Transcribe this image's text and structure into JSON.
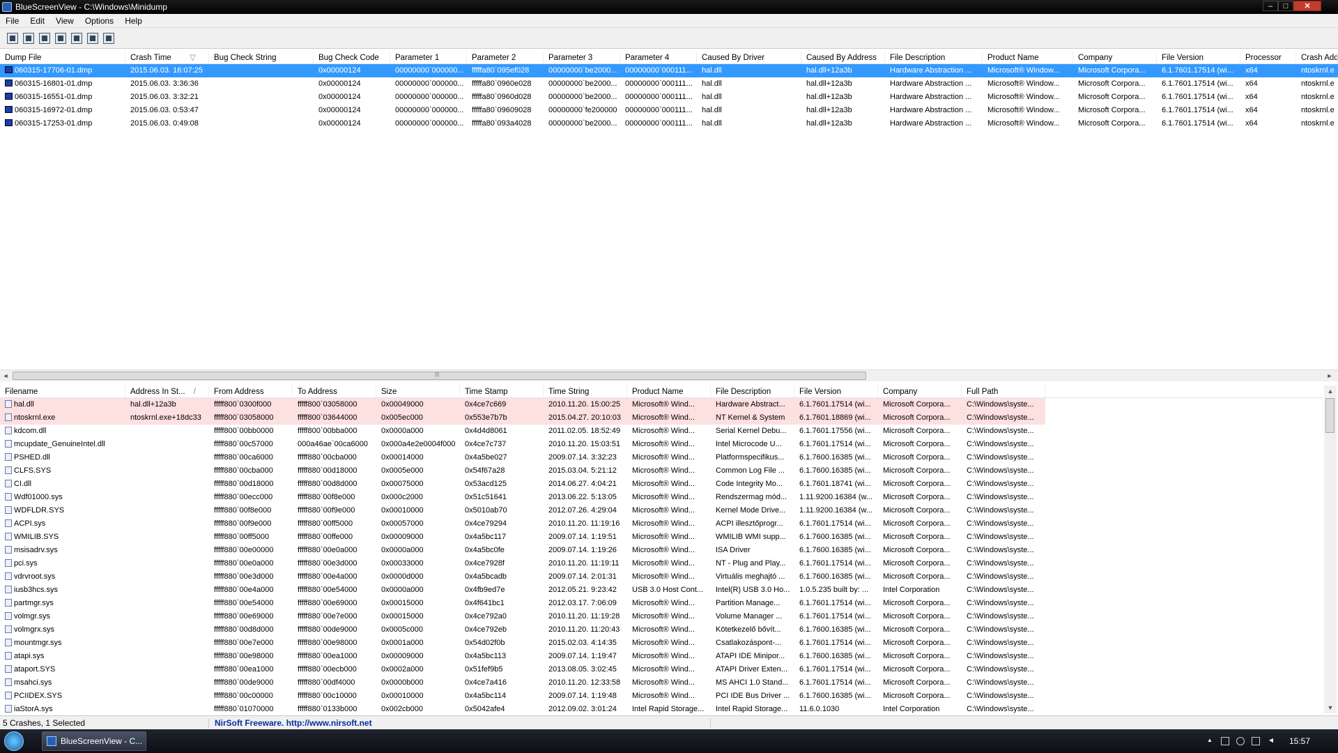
{
  "window": {
    "title": "BlueScreenView - C:\\Windows\\Minidump",
    "controls": {
      "minimize": "–",
      "maximize": "□",
      "close": "✕"
    }
  },
  "menu": [
    "File",
    "Edit",
    "View",
    "Options",
    "Help"
  ],
  "toolbar": {
    "icons": [
      "properties-icon",
      "save-icon",
      "refresh-icon",
      "copy-icon",
      "html-report-icon",
      "find-icon",
      "exit-icon"
    ]
  },
  "top_table": {
    "columns": [
      "Dump File",
      "Crash Time",
      "Bug Check String",
      "Bug Check Code",
      "Parameter 1",
      "Parameter 2",
      "Parameter 3",
      "Parameter 4",
      "Caused By Driver",
      "Caused By Address",
      "File Description",
      "Product Name",
      "Company",
      "File Version",
      "Processor",
      "Crash Add"
    ],
    "sort_indicator": "▽",
    "rows": [
      [
        "060315-17706-01.dmp",
        "2015.06.03. 16:07:25",
        "",
        "0x00000124",
        "00000000`000000...",
        "fffffa80`095ef028",
        "00000000`be2000...",
        "00000000`000111...",
        "hal.dll",
        "hal.dll+12a3b",
        "Hardware Abstraction ...",
        "Microsoft® Window...",
        "Microsoft Corpora...",
        "6.1.7601.17514 (wi...",
        "x64",
        "ntoskrnl.e"
      ],
      [
        "060315-16801-01.dmp",
        "2015.06.03. 3:36:36",
        "",
        "0x00000124",
        "00000000`000000...",
        "fffffa80`0960e028",
        "00000000`be2000...",
        "00000000`000111...",
        "hal.dll",
        "hal.dll+12a3b",
        "Hardware Abstraction ...",
        "Microsoft® Window...",
        "Microsoft Corpora...",
        "6.1.7601.17514 (wi...",
        "x64",
        "ntoskrnl.e"
      ],
      [
        "060315-16551-01.dmp",
        "2015.06.03. 3:32:21",
        "",
        "0x00000124",
        "00000000`000000...",
        "fffffa80`0960d028",
        "00000000`be2000...",
        "00000000`000111...",
        "hal.dll",
        "hal.dll+12a3b",
        "Hardware Abstraction ...",
        "Microsoft® Window...",
        "Microsoft Corpora...",
        "6.1.7601.17514 (wi...",
        "x64",
        "ntoskrnl.e"
      ],
      [
        "060315-16972-01.dmp",
        "2015.06.03. 0:53:47",
        "",
        "0x00000124",
        "00000000`000000...",
        "fffffa80`09609028",
        "00000000`fe200000",
        "00000000`000111...",
        "hal.dll",
        "hal.dll+12a3b",
        "Hardware Abstraction ...",
        "Microsoft® Window...",
        "Microsoft Corpora...",
        "6.1.7601.17514 (wi...",
        "x64",
        "ntoskrnl.e"
      ],
      [
        "060315-17253-01.dmp",
        "2015.06.03. 0:49:08",
        "",
        "0x00000124",
        "00000000`000000...",
        "fffffa80`093a4028",
        "00000000`be2000...",
        "00000000`000111...",
        "hal.dll",
        "hal.dll+12a3b",
        "Hardware Abstraction ...",
        "Microsoft® Window...",
        "Microsoft Corpora...",
        "6.1.7601.17514 (wi...",
        "x64",
        "ntoskrnl.e"
      ]
    ]
  },
  "scroll": {
    "left": "◄",
    "right": "►",
    "up": "▲",
    "down": "▼",
    "grip": "|||"
  },
  "bottom_table": {
    "columns": [
      "Filename",
      "Address In St...",
      "From Address",
      "To Address",
      "Size",
      "Time Stamp",
      "Time String",
      "Product Name",
      "File Description",
      "File Version",
      "Company",
      "Full Path"
    ],
    "sort_indicator": "/",
    "rows": [
      [
        "hal.dll",
        "hal.dll+12a3b",
        "fffff800`0300f000",
        "fffff800`03058000",
        "0x00049000",
        "0x4ce7c669",
        "2010.11.20. 15:00:25",
        "Microsoft® Wind...",
        "Hardware Abstract...",
        "6.1.7601.17514 (wi...",
        "Microsoft Corpora...",
        "C:\\Windows\\syste..."
      ],
      [
        "ntoskrnl.exe",
        "ntoskrnl.exe+18dc33",
        "fffff800`03058000",
        "fffff800`03644000",
        "0x005ec000",
        "0x553e7b7b",
        "2015.04.27. 20:10:03",
        "Microsoft® Wind...",
        "NT Kernel & System",
        "6.1.7601.18869 (wi...",
        "Microsoft Corpora...",
        "C:\\Windows\\syste..."
      ],
      [
        "kdcom.dll",
        "",
        "fffff800`00bb0000",
        "fffff800`00bba000",
        "0x0000a000",
        "0x4d4d8061",
        "2011.02.05. 18:52:49",
        "Microsoft® Wind...",
        "Serial Kernel Debu...",
        "6.1.7601.17556 (wi...",
        "Microsoft Corpora...",
        "C:\\Windows\\syste..."
      ],
      [
        "mcupdate_GenuineIntel.dll",
        "",
        "fffff880`00c57000",
        "000a46ae`00ca6000",
        "0x000a4e2e0004f000",
        "0x4ce7c737",
        "2010.11.20. 15:03:51",
        "Microsoft® Wind...",
        "Intel Microcode U...",
        "6.1.7601.17514 (wi...",
        "Microsoft Corpora...",
        "C:\\Windows\\syste..."
      ],
      [
        "PSHED.dll",
        "",
        "fffff880`00ca6000",
        "fffff880`00cba000",
        "0x00014000",
        "0x4a5be027",
        "2009.07.14. 3:32:23",
        "Microsoft® Wind...",
        "Platformspecifikus...",
        "6.1.7600.16385 (wi...",
        "Microsoft Corpora...",
        "C:\\Windows\\syste..."
      ],
      [
        "CLFS.SYS",
        "",
        "fffff880`00cba000",
        "fffff880`00d18000",
        "0x0005e000",
        "0x54f67a28",
        "2015.03.04. 5:21:12",
        "Microsoft® Wind...",
        "Common Log File ...",
        "6.1.7600.16385 (wi...",
        "Microsoft Corpora...",
        "C:\\Windows\\syste..."
      ],
      [
        "CI.dll",
        "",
        "fffff880`00d18000",
        "fffff880`00d8d000",
        "0x00075000",
        "0x53acd125",
        "2014.06.27. 4:04:21",
        "Microsoft® Wind...",
        "Code Integrity Mo...",
        "6.1.7601.18741 (wi...",
        "Microsoft Corpora...",
        "C:\\Windows\\syste..."
      ],
      [
        "Wdf01000.sys",
        "",
        "fffff880`00ecc000",
        "fffff880`00f8e000",
        "0x000c2000",
        "0x51c51641",
        "2013.06.22. 5:13:05",
        "Microsoft® Wind...",
        "Rendszermag mód...",
        "1.11.9200.16384 (w...",
        "Microsoft Corpora...",
        "C:\\Windows\\syste..."
      ],
      [
        "WDFLDR.SYS",
        "",
        "fffff880`00f8e000",
        "fffff880`00f9e000",
        "0x00010000",
        "0x5010ab70",
        "2012.07.26. 4:29:04",
        "Microsoft® Wind...",
        "Kernel Mode Drive...",
        "1.11.9200.16384 (w...",
        "Microsoft Corpora...",
        "C:\\Windows\\syste..."
      ],
      [
        "ACPI.sys",
        "",
        "fffff880`00f9e000",
        "fffff880`00ff5000",
        "0x00057000",
        "0x4ce79294",
        "2010.11.20. 11:19:16",
        "Microsoft® Wind...",
        "ACPI illesztőprogr...",
        "6.1.7601.17514 (wi...",
        "Microsoft Corpora...",
        "C:\\Windows\\syste..."
      ],
      [
        "WMILIB.SYS",
        "",
        "fffff880`00ff5000",
        "fffff880`00ffe000",
        "0x00009000",
        "0x4a5bc117",
        "2009.07.14. 1:19:51",
        "Microsoft® Wind...",
        "WMILIB WMI supp...",
        "6.1.7600.16385 (wi...",
        "Microsoft Corpora...",
        "C:\\Windows\\syste..."
      ],
      [
        "msisadrv.sys",
        "",
        "fffff880`00e00000",
        "fffff880`00e0a000",
        "0x0000a000",
        "0x4a5bc0fe",
        "2009.07.14. 1:19:26",
        "Microsoft® Wind...",
        "ISA Driver",
        "6.1.7600.16385 (wi...",
        "Microsoft Corpora...",
        "C:\\Windows\\syste..."
      ],
      [
        "pci.sys",
        "",
        "fffff880`00e0a000",
        "fffff880`00e3d000",
        "0x00033000",
        "0x4ce7928f",
        "2010.11.20. 11:19:11",
        "Microsoft® Wind...",
        "NT - Plug and Play...",
        "6.1.7601.17514 (wi...",
        "Microsoft Corpora...",
        "C:\\Windows\\syste..."
      ],
      [
        "vdrvroot.sys",
        "",
        "fffff880`00e3d000",
        "fffff880`00e4a000",
        "0x0000d000",
        "0x4a5bcadb",
        "2009.07.14. 2:01:31",
        "Microsoft® Wind...",
        "Virtuális meghajtó ...",
        "6.1.7600.16385 (wi...",
        "Microsoft Corpora...",
        "C:\\Windows\\syste..."
      ],
      [
        "iusb3hcs.sys",
        "",
        "fffff880`00e4a000",
        "fffff880`00e54000",
        "0x0000a000",
        "0x4fb9ed7e",
        "2012.05.21. 9:23:42",
        "USB 3.0 Host Cont...",
        "Intel(R) USB 3.0 Ho...",
        "1.0.5.235 built by: ...",
        "Intel Corporation",
        "C:\\Windows\\syste..."
      ],
      [
        "partmgr.sys",
        "",
        "fffff880`00e54000",
        "fffff880`00e69000",
        "0x00015000",
        "0x4f641bc1",
        "2012.03.17. 7:06:09",
        "Microsoft® Wind...",
        "Partition Manage...",
        "6.1.7601.17514 (wi...",
        "Microsoft Corpora...",
        "C:\\Windows\\syste..."
      ],
      [
        "volmgr.sys",
        "",
        "fffff880`00e69000",
        "fffff880`00e7e000",
        "0x00015000",
        "0x4ce792a0",
        "2010.11.20. 11:19:28",
        "Microsoft® Wind...",
        "Volume Manager ...",
        "6.1.7601.17514 (wi...",
        "Microsoft Corpora...",
        "C:\\Windows\\syste..."
      ],
      [
        "volmgrx.sys",
        "",
        "fffff880`00d8d000",
        "fffff880`00de9000",
        "0x0005c000",
        "0x4ce792eb",
        "2010.11.20. 11:20:43",
        "Microsoft® Wind...",
        "Kötetkezelő bővít...",
        "6.1.7600.16385 (wi...",
        "Microsoft Corpora...",
        "C:\\Windows\\syste..."
      ],
      [
        "mountmgr.sys",
        "",
        "fffff880`00e7e000",
        "fffff880`00e98000",
        "0x0001a000",
        "0x54d02f0b",
        "2015.02.03. 4:14:35",
        "Microsoft® Wind...",
        "Csatlakozáspont-...",
        "6.1.7601.17514 (wi...",
        "Microsoft Corpora...",
        "C:\\Windows\\syste..."
      ],
      [
        "atapi.sys",
        "",
        "fffff880`00e98000",
        "fffff880`00ea1000",
        "0x00009000",
        "0x4a5bc113",
        "2009.07.14. 1:19:47",
        "Microsoft® Wind...",
        "ATAPI IDE Minipor...",
        "6.1.7600.16385 (wi...",
        "Microsoft Corpora...",
        "C:\\Windows\\syste..."
      ],
      [
        "ataport.SYS",
        "",
        "fffff880`00ea1000",
        "fffff880`00ecb000",
        "0x0002a000",
        "0x51fef9b5",
        "2013.08.05. 3:02:45",
        "Microsoft® Wind...",
        "ATAPI Driver Exten...",
        "6.1.7601.17514 (wi...",
        "Microsoft Corpora...",
        "C:\\Windows\\syste..."
      ],
      [
        "msahci.sys",
        "",
        "fffff880`00de9000",
        "fffff880`00df4000",
        "0x0000b000",
        "0x4ce7a416",
        "2010.11.20. 12:33:58",
        "Microsoft® Wind...",
        "MS AHCI 1.0 Stand...",
        "6.1.7601.17514 (wi...",
        "Microsoft Corpora...",
        "C:\\Windows\\syste..."
      ],
      [
        "PCIIDEX.SYS",
        "",
        "fffff880`00c00000",
        "fffff880`00c10000",
        "0x00010000",
        "0x4a5bc114",
        "2009.07.14. 1:19:48",
        "Microsoft® Wind...",
        "PCI IDE Bus Driver ...",
        "6.1.7600.16385 (wi...",
        "Microsoft Corpora...",
        "C:\\Windows\\syste..."
      ],
      [
        "iaStorA.sys",
        "",
        "fffff880`01070000",
        "fffff880`0133b000",
        "0x002cb000",
        "0x5042afe4",
        "2012.09.02. 3:01:24",
        "Intel Rapid Storage...",
        "Intel Rapid Storage...",
        "11.6.0.1030",
        "Intel Corporation",
        "C:\\Windows\\syste..."
      ]
    ]
  },
  "status": {
    "count": "5 Crashes, 1 Selected",
    "credit": "NirSoft Freeware.  http://www.nirsoft.net"
  },
  "taskbar": {
    "task_label": "BlueScreenView - C...",
    "clock": "15:57"
  },
  "colors": {
    "selection": "#3399ff",
    "highlight_rows": "#fde0e0"
  }
}
